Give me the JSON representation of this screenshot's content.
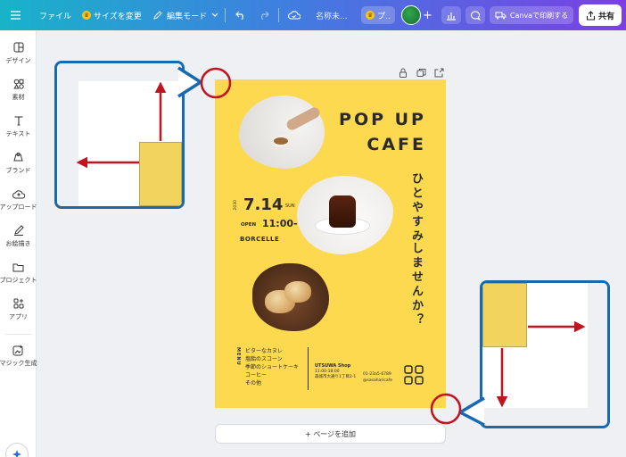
{
  "topbar": {
    "menu_icon": "hamburger-icon",
    "file_label": "ファイル",
    "resize_label": "サイズを変更",
    "edit_mode_label": "編集モード",
    "doc_name": "名称未...",
    "pro_label": "プ..",
    "print_label": "Canvaで印刷する",
    "share_label": "共有"
  },
  "sidebar": {
    "items": [
      {
        "label": "デザイン",
        "icon": "design-icon"
      },
      {
        "label": "素材",
        "icon": "elements-icon"
      },
      {
        "label": "テキスト",
        "icon": "text-icon"
      },
      {
        "label": "ブランド",
        "icon": "brand-icon"
      },
      {
        "label": "アップロード",
        "icon": "upload-icon"
      },
      {
        "label": "お絵描き",
        "icon": "draw-icon"
      },
      {
        "label": "プロジェクト",
        "icon": "folder-icon"
      },
      {
        "label": "アプリ",
        "icon": "apps-icon"
      },
      {
        "label": "マジック生成",
        "icon": "magic-icon"
      }
    ]
  },
  "poster": {
    "title_line1": "POP UP",
    "title_line2": "CAFE",
    "vertical_1": "ひとやすみ",
    "vertical_2": "しませんか？",
    "year": "2030",
    "date": "7.14",
    "weekday": "SUN",
    "open_label": "OPEN",
    "open_time": "11:00-",
    "brand": "BORCELLE",
    "menu_label": "MENU",
    "menu_items": [
      "ビターなカヌレ",
      "塩飴のスコーン",
      "季節のショートケーキ",
      "コーヒー",
      "その他"
    ],
    "shop_name": "UTSUWA Shop",
    "shop_hours": "11:00-18:00",
    "shop_address": "森城市大通り1丁目2-1",
    "phone": "01-23a5-6789",
    "sns": "@sasaharicafe"
  },
  "canvas": {
    "add_page_label": "+ ページを追加"
  },
  "colors": {
    "poster_yellow": "#fcd94e",
    "callout_blue": "#1769b0",
    "arrow_red": "#c0141f"
  }
}
